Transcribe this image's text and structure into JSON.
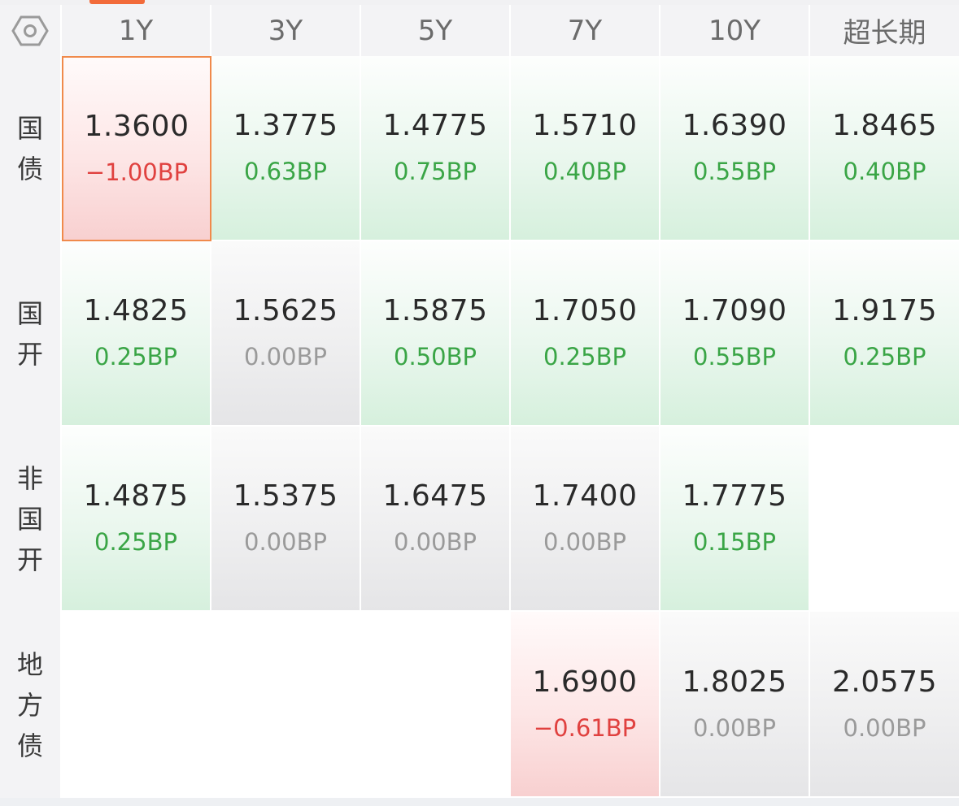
{
  "header": {
    "settings_icon": "hexagon-settings-icon",
    "columns": [
      "1Y",
      "3Y",
      "5Y",
      "7Y",
      "10Y",
      "超长期"
    ]
  },
  "rows": [
    {
      "label": [
        "国",
        "债"
      ],
      "cells": [
        {
          "rate": "1.3600",
          "change": "−1.00BP",
          "trend": "down",
          "selected": true
        },
        {
          "rate": "1.3775",
          "change": "0.63BP",
          "trend": "up"
        },
        {
          "rate": "1.4775",
          "change": "0.75BP",
          "trend": "up"
        },
        {
          "rate": "1.5710",
          "change": "0.40BP",
          "trend": "up"
        },
        {
          "rate": "1.6390",
          "change": "0.55BP",
          "trend": "up"
        },
        {
          "rate": "1.8465",
          "change": "0.40BP",
          "trend": "up"
        }
      ]
    },
    {
      "label": [
        "国",
        "开"
      ],
      "cells": [
        {
          "rate": "1.4825",
          "change": "0.25BP",
          "trend": "up"
        },
        {
          "rate": "1.5625",
          "change": "0.00BP",
          "trend": "flat"
        },
        {
          "rate": "1.5875",
          "change": "0.50BP",
          "trend": "up"
        },
        {
          "rate": "1.7050",
          "change": "0.25BP",
          "trend": "up"
        },
        {
          "rate": "1.7090",
          "change": "0.55BP",
          "trend": "up"
        },
        {
          "rate": "1.9175",
          "change": "0.25BP",
          "trend": "up"
        }
      ]
    },
    {
      "label": [
        "非",
        "国",
        "开"
      ],
      "cells": [
        {
          "rate": "1.4875",
          "change": "0.25BP",
          "trend": "up"
        },
        {
          "rate": "1.5375",
          "change": "0.00BP",
          "trend": "flat"
        },
        {
          "rate": "1.6475",
          "change": "0.00BP",
          "trend": "flat"
        },
        {
          "rate": "1.7400",
          "change": "0.00BP",
          "trend": "flat"
        },
        {
          "rate": "1.7775",
          "change": "0.15BP",
          "trend": "up"
        },
        {
          "rate": "",
          "change": "",
          "trend": "empty"
        }
      ]
    },
    {
      "label": [
        "地",
        "方",
        "债"
      ],
      "cells": [
        {
          "rate": "",
          "change": "",
          "trend": "empty"
        },
        {
          "rate": "",
          "change": "",
          "trend": "empty"
        },
        {
          "rate": "",
          "change": "",
          "trend": "empty"
        },
        {
          "rate": "1.6900",
          "change": "−0.61BP",
          "trend": "down"
        },
        {
          "rate": "1.8025",
          "change": "0.00BP",
          "trend": "flat"
        },
        {
          "rate": "2.0575",
          "change": "0.00BP",
          "trend": "flat"
        }
      ]
    }
  ],
  "colors": {
    "up": "#3aa546",
    "flat": "#9a9a9a",
    "down": "#e0413f",
    "selected_border": "#f08a4b",
    "accent": "#f26b3a"
  }
}
